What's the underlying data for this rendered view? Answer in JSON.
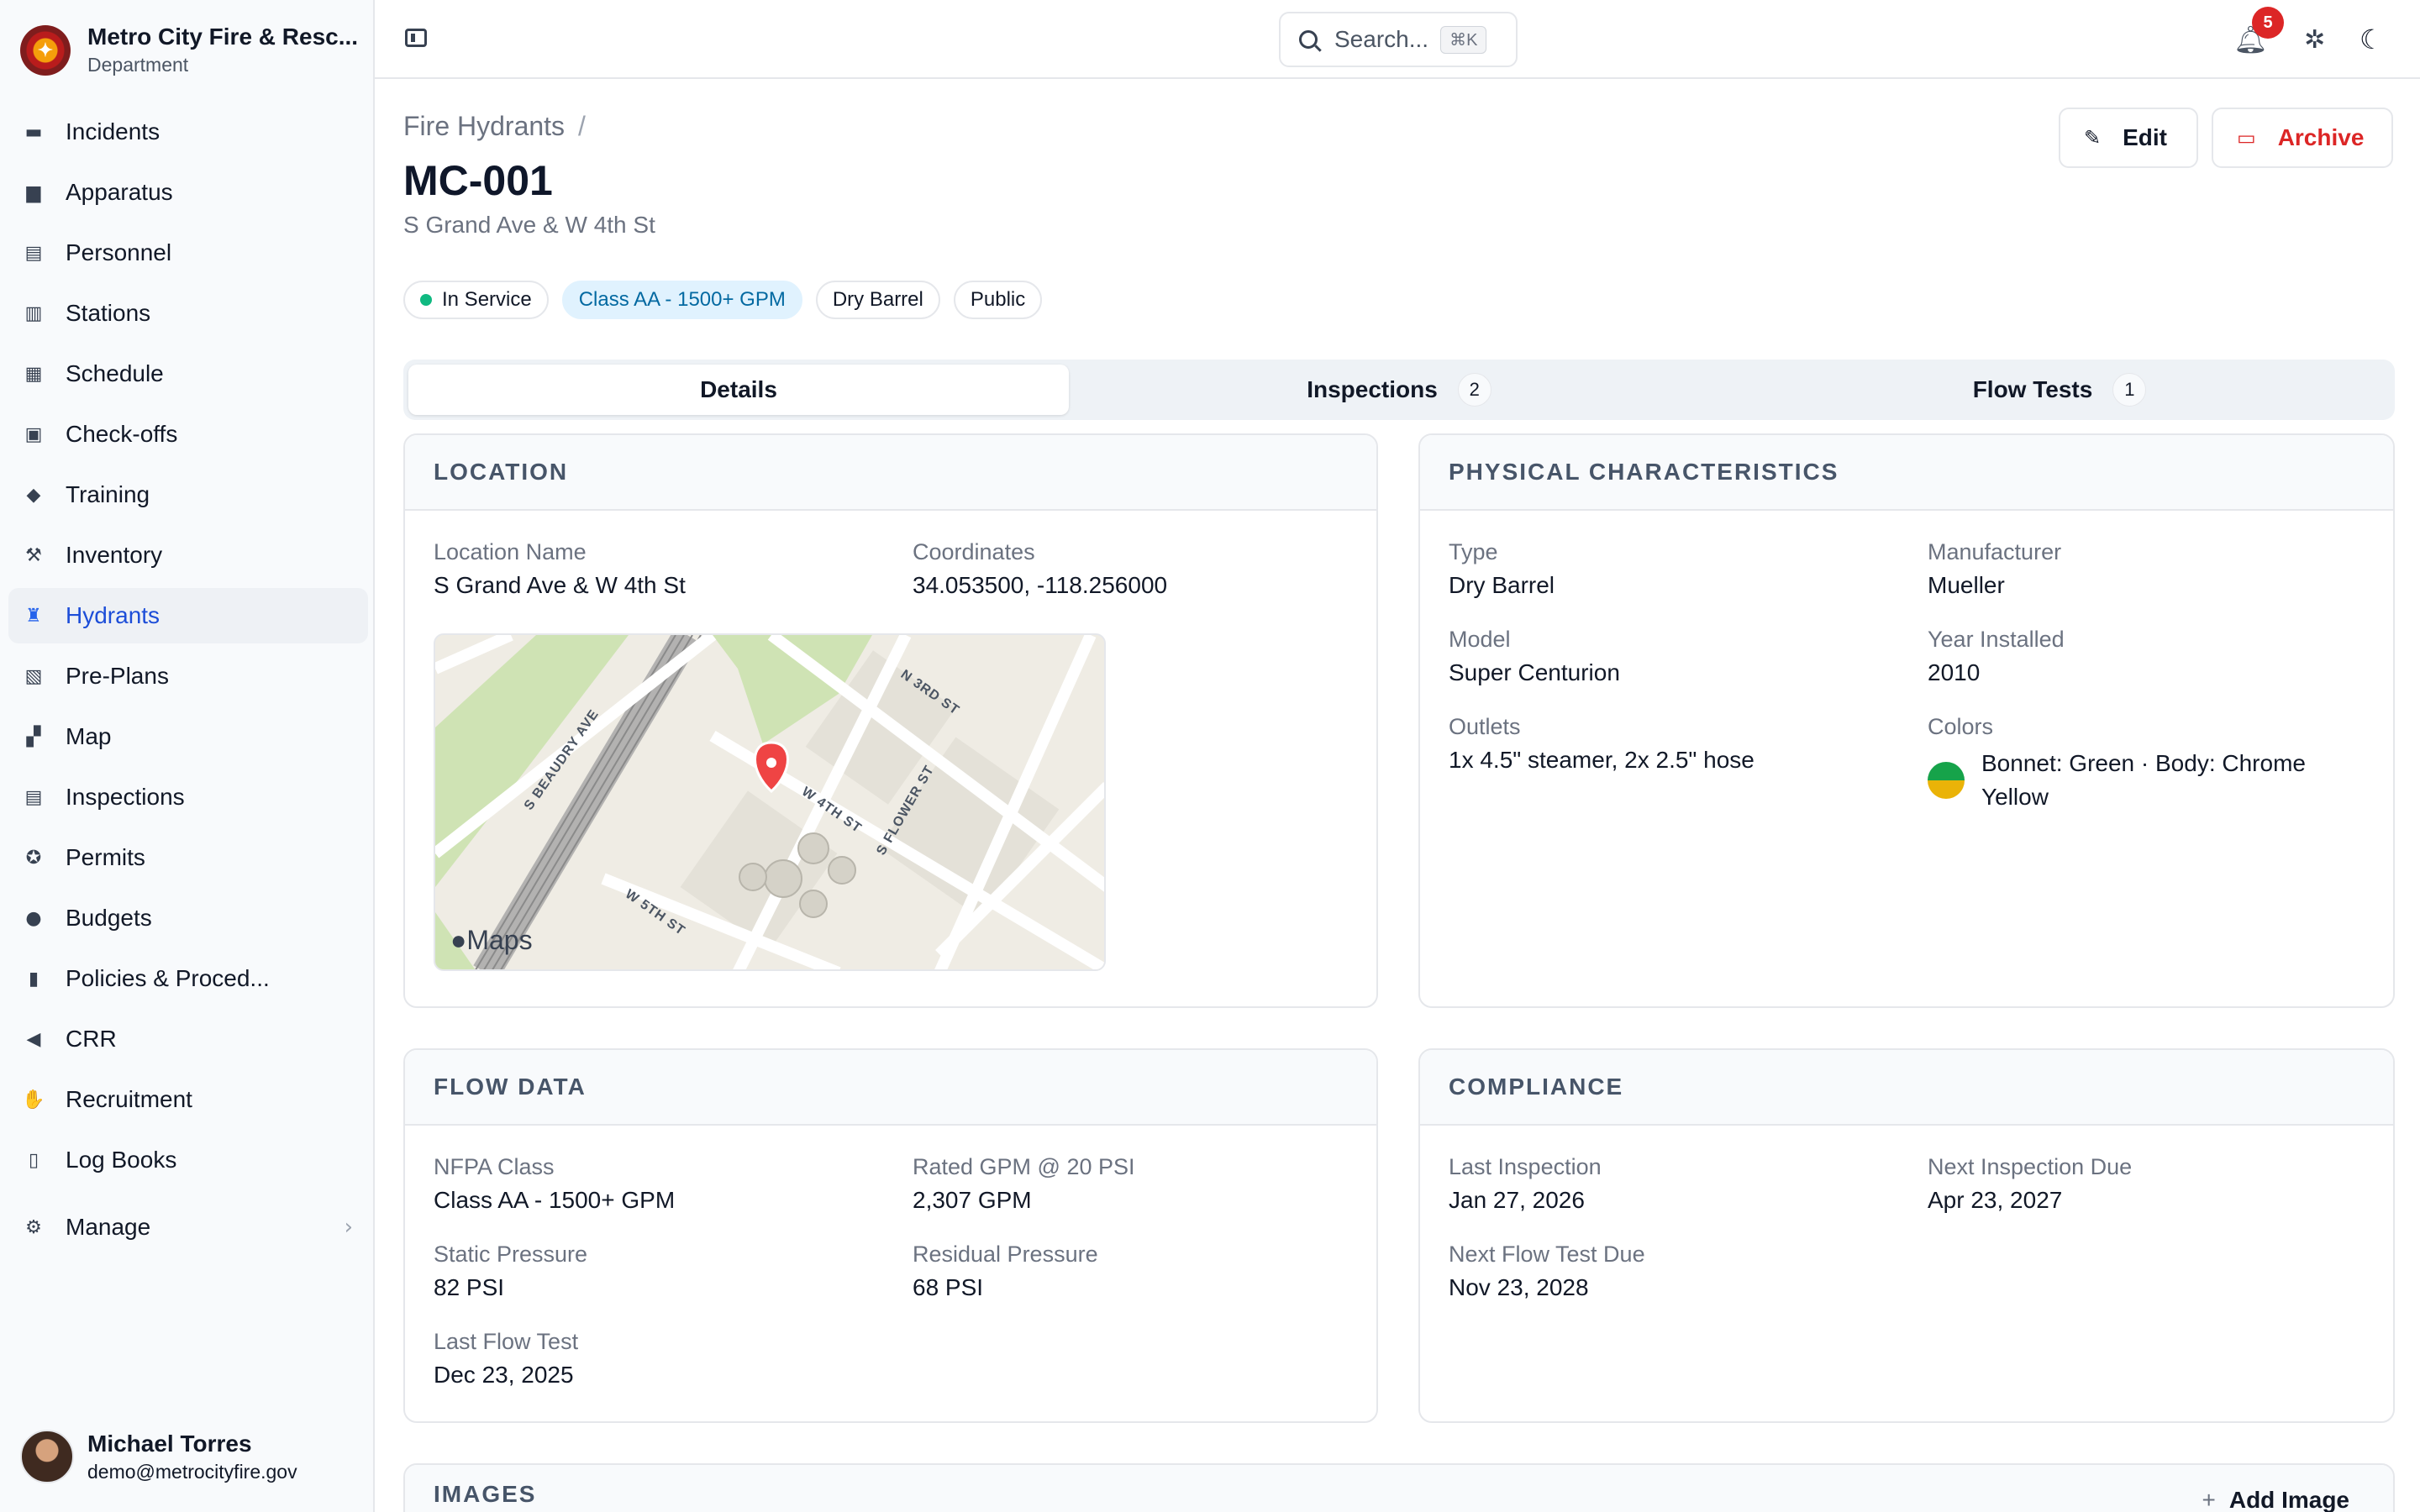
{
  "org": {
    "name": "Metro City Fire & Resc...",
    "sub": "Department"
  },
  "nav": [
    {
      "label": "Incidents",
      "icon": "fire-truck-icon"
    },
    {
      "label": "Apparatus",
      "icon": "truck-icon"
    },
    {
      "label": "Personnel",
      "icon": "id-card-icon"
    },
    {
      "label": "Stations",
      "icon": "building-icon"
    },
    {
      "label": "Schedule",
      "icon": "calendar-icon"
    },
    {
      "label": "Check-offs",
      "icon": "clipboard-check-icon"
    },
    {
      "label": "Training",
      "icon": "graduation-cap-icon"
    },
    {
      "label": "Inventory",
      "icon": "wrench-icon"
    },
    {
      "label": "Hydrants",
      "icon": "hydrant-icon",
      "active": true
    },
    {
      "label": "Pre-Plans",
      "icon": "building-plan-icon"
    },
    {
      "label": "Map",
      "icon": "map-icon"
    },
    {
      "label": "Inspections",
      "icon": "clipboard-list-icon"
    },
    {
      "label": "Permits",
      "icon": "badge-icon"
    },
    {
      "label": "Budgets",
      "icon": "piggy-bank-icon"
    },
    {
      "label": "Policies & Proced...",
      "icon": "book-icon"
    },
    {
      "label": "CRR",
      "icon": "megaphone-icon"
    },
    {
      "label": "Recruitment",
      "icon": "handshake-icon"
    },
    {
      "label": "Log Books",
      "icon": "books-icon"
    }
  ],
  "manage": {
    "label": "Manage",
    "icon": "gear-icon"
  },
  "user": {
    "name": "Michael Torres",
    "email": "demo@metrocityfire.gov"
  },
  "topbar": {
    "search_label": "Search...",
    "shortcut": "⌘K",
    "notifications": "5"
  },
  "header": {
    "breadcrumb": "Fire Hydrants",
    "breadcrumb_sep": "/",
    "title": "MC-001",
    "subtitle": "S Grand Ave & W 4th St",
    "edit_label": "Edit",
    "archive_label": "Archive"
  },
  "tags": {
    "status": "In Service",
    "class": "Class AA - 1500+ GPM",
    "type": "Dry Barrel",
    "visibility": "Public"
  },
  "tabs": [
    {
      "label": "Details"
    },
    {
      "label": "Inspections",
      "count": "2"
    },
    {
      "label": "Flow Tests",
      "count": "1"
    }
  ],
  "location": {
    "heading": "LOCATION",
    "name_label": "Location Name",
    "name_value": "S Grand Ave & W 4th St",
    "coords_label": "Coordinates",
    "coords_value": "34.053500, -118.256000",
    "map": {
      "streets": [
        "S BEAUDRY AVE",
        "N 3RD ST",
        "S FLOWER ST",
        "W 4TH ST",
        "W 5TH ST"
      ],
      "attribution": "Maps"
    }
  },
  "physical": {
    "heading": "PHYSICAL CHARACTERISTICS",
    "type_label": "Type",
    "type_value": "Dry Barrel",
    "manufacturer_label": "Manufacturer",
    "manufacturer_value": "Mueller",
    "model_label": "Model",
    "model_value": "Super Centurion",
    "year_label": "Year Installed",
    "year_value": "2010",
    "outlets_label": "Outlets",
    "outlets_value": "1x 4.5\" steamer, 2x 2.5\" hose",
    "colors_label": "Colors",
    "colors_value": "Bonnet: Green · Body: Chrome Yellow",
    "swatch_colors": [
      "#16a34a",
      "#eab308"
    ]
  },
  "flow": {
    "heading": "FLOW DATA",
    "nfpa_label": "NFPA Class",
    "nfpa_value": "Class AA - 1500+ GPM",
    "rated_label": "Rated GPM @ 20 PSI",
    "rated_value": "2,307 GPM",
    "static_label": "Static Pressure",
    "static_value": "82 PSI",
    "residual_label": "Residual Pressure",
    "residual_value": "68 PSI",
    "last_label": "Last Flow Test",
    "last_value": "Dec 23, 2025"
  },
  "compliance": {
    "heading": "COMPLIANCE",
    "last_label": "Last Inspection",
    "last_value": "Jan 27, 2026",
    "next_label": "Next Inspection Due",
    "next_value": "Apr 23, 2027",
    "flow_label": "Next Flow Test Due",
    "flow_value": "Nov 23, 2028"
  },
  "images": {
    "heading": "IMAGES",
    "add_label": "Add Image"
  },
  "colors": {
    "accent": "#2563eb",
    "danger": "#dc2626",
    "success": "#10b981"
  }
}
